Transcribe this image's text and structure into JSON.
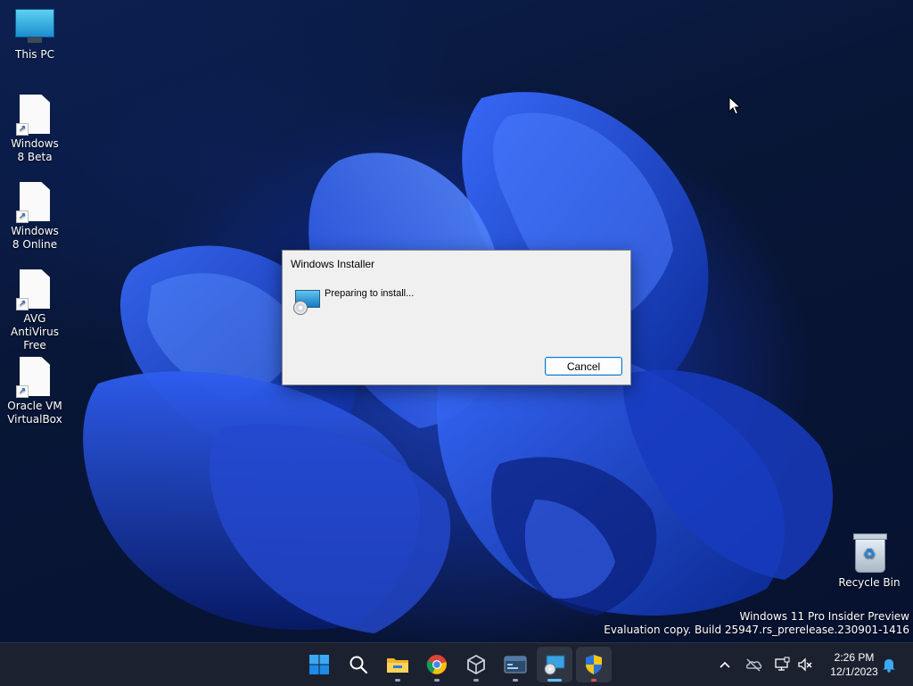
{
  "desktop": {
    "icons": [
      {
        "label": "This PC",
        "icon": "this-pc-icon"
      },
      {
        "label": "Windows 8 Beta",
        "icon": "document-shortcut-icon"
      },
      {
        "label": "Windows 8 Online",
        "icon": "document-shortcut-icon"
      },
      {
        "label": "AVG AntiVirus Free",
        "icon": "document-shortcut-icon"
      },
      {
        "label": "Oracle VM VirtualBox",
        "icon": "document-shortcut-icon"
      },
      {
        "label": "Recycle Bin",
        "icon": "recycle-bin-icon"
      }
    ],
    "watermark": {
      "line1": "Windows 11 Pro Insider Preview",
      "line2": "Evaluation copy. Build 25947.rs_prerelease.230901-1416"
    }
  },
  "dialog": {
    "title": "Windows Installer",
    "message": "Preparing to install...",
    "cancel_label": "Cancel"
  },
  "taskbar": {
    "apps": [
      {
        "name": "Start",
        "icon": "windows-logo-icon"
      },
      {
        "name": "Search",
        "icon": "search-icon"
      },
      {
        "name": "File Explorer",
        "icon": "folder-icon"
      },
      {
        "name": "Google Chrome",
        "icon": "chrome-icon"
      },
      {
        "name": "Oracle VM VirtualBox",
        "icon": "virtualbox-icon"
      },
      {
        "name": "Terminal",
        "icon": "terminal-icon"
      },
      {
        "name": "Windows Installer",
        "icon": "installer-icon"
      },
      {
        "name": "Security",
        "icon": "shield-icon"
      }
    ],
    "tray": {
      "time": "2:26 PM",
      "date": "12/1/2023"
    }
  },
  "colors": {
    "accent": "#0078d4",
    "taskbar": "#1c2130"
  }
}
